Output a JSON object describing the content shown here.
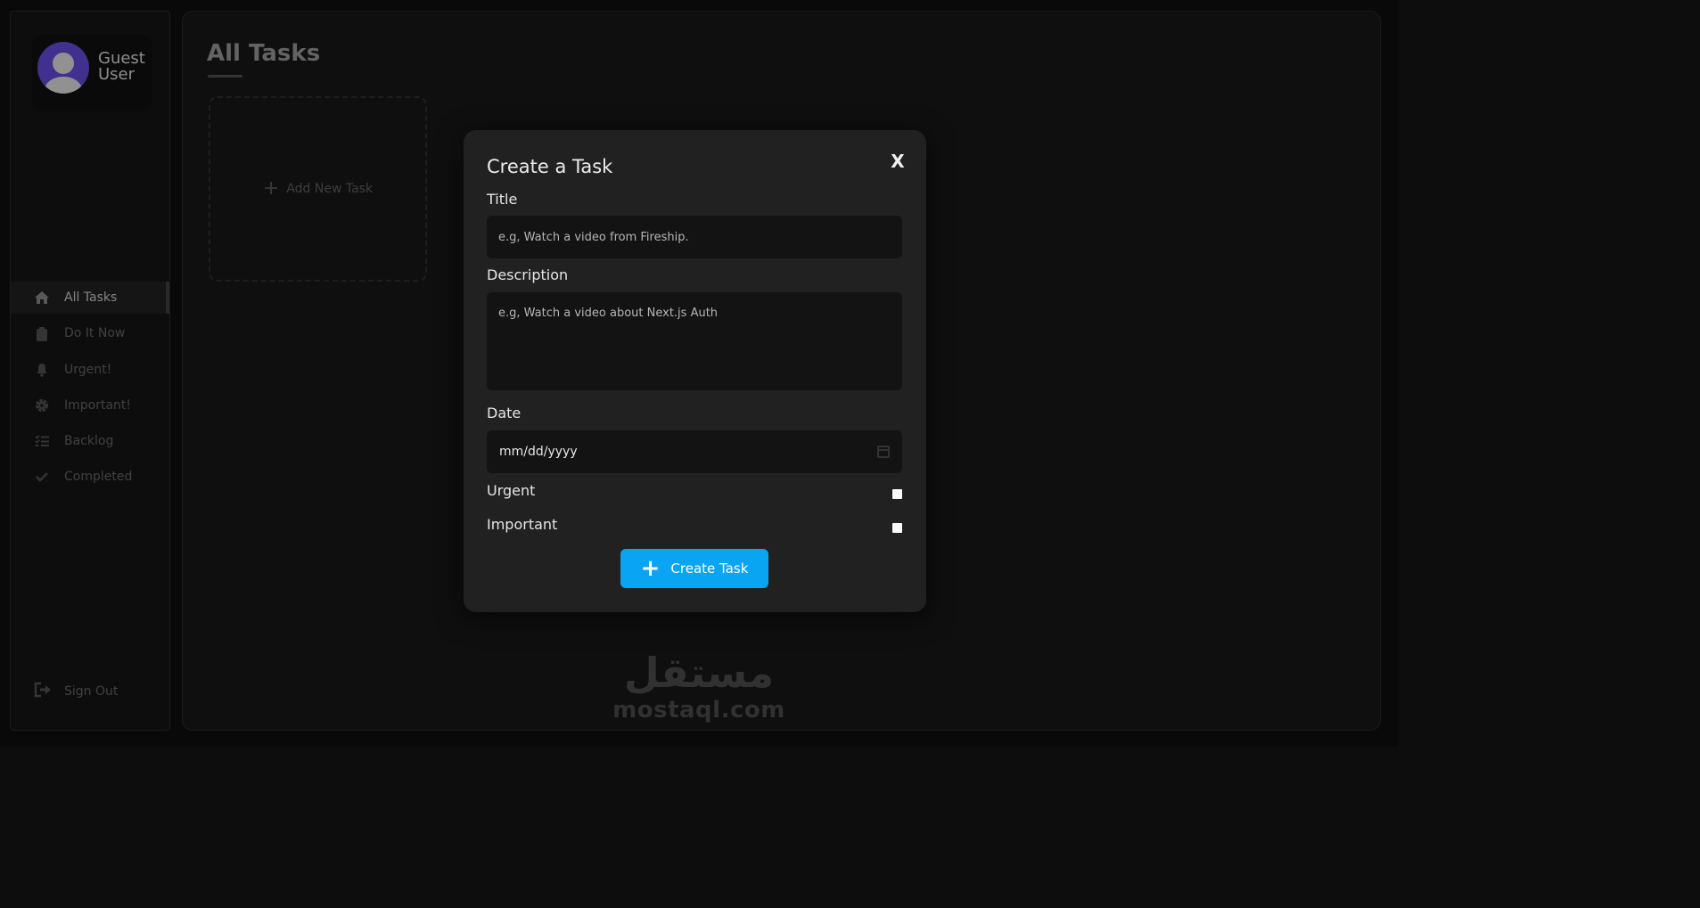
{
  "user": {
    "name": "Guest User"
  },
  "sidebar": {
    "items": [
      {
        "label": "All Tasks",
        "icon": "home-icon",
        "active": true
      },
      {
        "label": "Do It Now",
        "icon": "clipboard-icon",
        "active": false
      },
      {
        "label": "Urgent!",
        "icon": "bell-icon",
        "active": false
      },
      {
        "label": "Important!",
        "icon": "gear-icon",
        "active": false
      },
      {
        "label": "Backlog",
        "icon": "list-check-icon",
        "active": false
      },
      {
        "label": "Completed",
        "icon": "check-icon",
        "active": false
      }
    ],
    "signout_label": "Sign Out",
    "signout_icon": "sign-out-icon"
  },
  "main": {
    "title": "All Tasks",
    "add_task_label": "Add New Task"
  },
  "modal": {
    "title": "Create a Task",
    "close_label": "X",
    "title_label": "Title",
    "title_placeholder": "e.g, Watch a video from Fireship.",
    "description_label": "Description",
    "description_placeholder": "e.g, Watch a video about Next.js Auth",
    "date_label": "Date",
    "date_placeholder": "mm/dd/yyyy",
    "urgent_label": "Urgent",
    "important_label": "Important",
    "submit_label": "Create Task"
  },
  "watermark": {
    "arabic": "مستقل",
    "latin": "mostaql.com"
  },
  "colors": {
    "accent": "#0aa5f2",
    "avatar": "#5b43c4"
  }
}
